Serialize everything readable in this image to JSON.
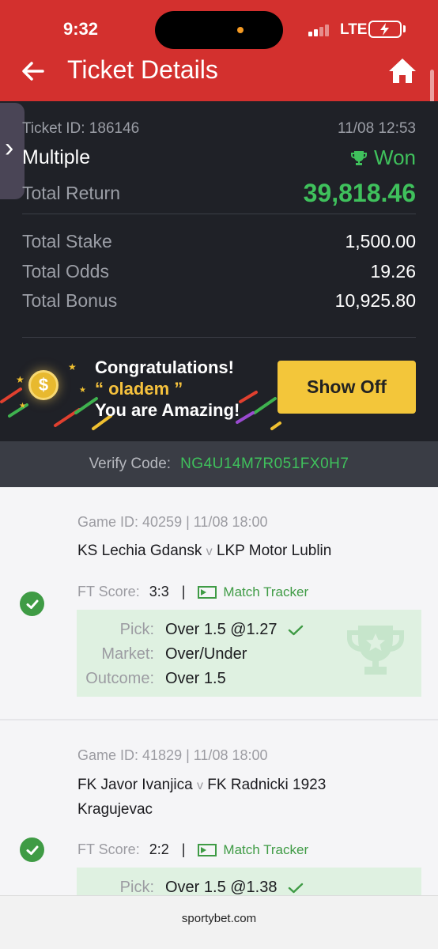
{
  "status_bar": {
    "time": "9:32",
    "network": "LTE"
  },
  "header": {
    "title": "Ticket Details"
  },
  "ticket": {
    "id_label": "Ticket ID: 186146",
    "datetime": "11/08 12:53",
    "bet_type": "Multiple",
    "status": "Won",
    "total_return_label": "Total Return",
    "total_return": "39,818.46",
    "total_stake_label": "Total Stake",
    "total_stake": "1,500.00",
    "total_odds_label": "Total Odds",
    "total_odds": "19.26",
    "total_bonus_label": "Total Bonus",
    "total_bonus": "10,925.80"
  },
  "celebration": {
    "line1": "Congratulations!",
    "username_line": "“ oladem ”",
    "line3": "You are Amazing!",
    "show_off_label": "Show Off"
  },
  "verify": {
    "label": "Verify Code:",
    "code": "NG4U14M7R051FX0H7"
  },
  "games": [
    {
      "meta": "Game ID: 40259 | 11/08 18:00",
      "home": "KS Lechia Gdansk",
      "vs": "v",
      "away": "LKP Motor Lublin",
      "score_label": "FT Score:",
      "score": "3:3",
      "tracker_label": "Match Tracker",
      "pick_label": "Pick:",
      "pick": "Over 1.5 @1.27",
      "market_label": "Market:",
      "market": "Over/Under",
      "outcome_label": "Outcome:",
      "outcome": "Over 1.5"
    },
    {
      "meta": "Game ID: 41829 | 11/08 18:00",
      "home": "FK Javor Ivanjica",
      "vs": "v",
      "away": "FK Radnicki 1923 Kragujevac",
      "score_label": "FT Score:",
      "score": "2:2",
      "tracker_label": "Match Tracker",
      "pick_label": "Pick:",
      "pick": "Over 1.5 @1.38"
    }
  ],
  "browser": {
    "url": "sportybet.com"
  },
  "colors": {
    "brand_red": "#d3302e",
    "win_green": "#3fc15c",
    "show_off_yellow": "#f3c63a"
  }
}
